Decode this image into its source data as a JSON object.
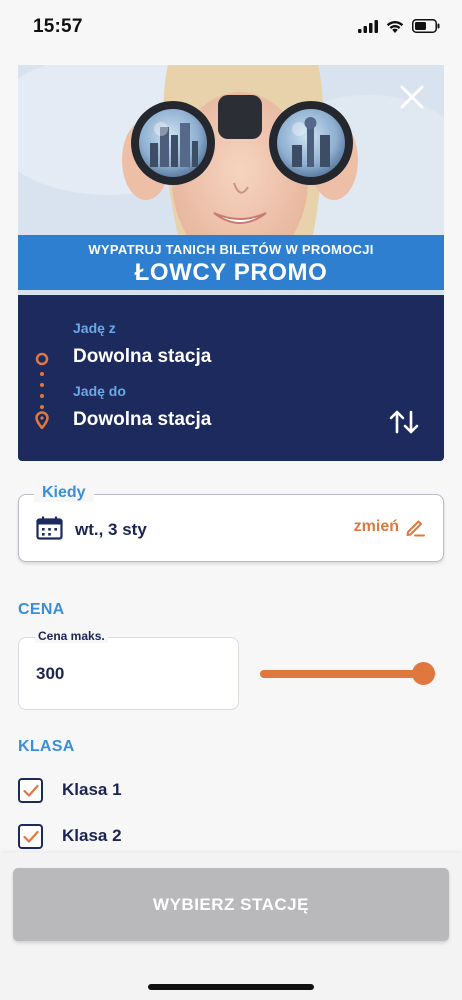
{
  "status_bar": {
    "time": "15:57"
  },
  "banner": {
    "promo_small": "WYPATRUJ TANICH BILETÓW W PROMOCJI",
    "promo_big": "ŁOWCY PROMO"
  },
  "route": {
    "from_label": "Jadę z",
    "from_value": "Dowolna stacja",
    "to_label": "Jadę do",
    "to_value": "Dowolna stacja"
  },
  "when": {
    "legend": "Kiedy",
    "date": "wt., 3 sty",
    "change_label": "zmień"
  },
  "price": {
    "section_title": "CENA",
    "field_label": "Cena maks.",
    "value": "300",
    "slider_level": 1.0
  },
  "class": {
    "section_title": "KLASA",
    "options": [
      {
        "label": "Klasa 1",
        "checked": true
      },
      {
        "label": "Klasa 2",
        "checked": true
      }
    ]
  },
  "cta_label": "WYBIERZ STACJĘ",
  "colors": {
    "accent_orange": "#e0773f",
    "navy": "#1d2a5e",
    "blue_label": "#3a8fd6",
    "promo_band": "#2f7fd0",
    "cta_disabled": "#b9b9bb"
  },
  "icons": [
    "signal-icon",
    "wifi-icon",
    "battery-icon",
    "close-icon",
    "origin-pin-icon",
    "destination-pin-icon",
    "swap-icon",
    "calendar-icon",
    "pencil-icon",
    "checkmark-icon"
  ]
}
